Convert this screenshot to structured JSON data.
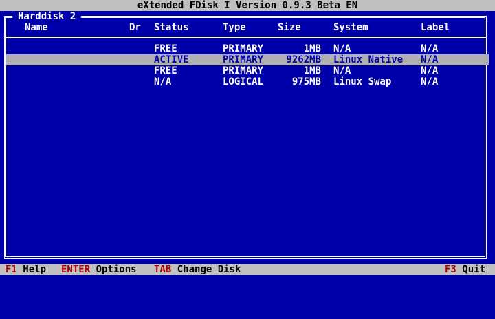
{
  "app": {
    "title": "eXtended FDisk I Version 0.9.3 Beta EN"
  },
  "panel": {
    "title": "Harddisk 2",
    "columns": {
      "name": "Name",
      "drive": "Dr",
      "status": "Status",
      "type": "Type",
      "size": "Size",
      "system": "System",
      "label": "Label"
    },
    "rows": [
      {
        "name": "",
        "drive": "",
        "status": "FREE",
        "type": "PRIMARY",
        "size": "1MB",
        "system": "N/A",
        "label": "N/A"
      },
      {
        "name": "",
        "drive": "",
        "status": "ACTIVE",
        "type": "PRIMARY",
        "size": "9262MB",
        "system": "Linux Native",
        "label": "N/A"
      },
      {
        "name": "",
        "drive": "",
        "status": "FREE",
        "type": "PRIMARY",
        "size": "1MB",
        "system": "N/A",
        "label": "N/A"
      },
      {
        "name": "",
        "drive": "",
        "status": "N/A",
        "type": "LOGICAL",
        "size": "975MB",
        "system": "Linux Swap",
        "label": "N/A"
      }
    ],
    "selected_row_index": 1
  },
  "footer": {
    "f1_key": "F1",
    "f1_label": "Help",
    "enter_key": "ENTER",
    "enter_label": "Options",
    "tab_key": "TAB",
    "tab_label": "Change Disk",
    "f3_key": "F3",
    "f3_label": "Quit"
  },
  "colors": {
    "background": "#0000aa",
    "bar": "#c0c0c0",
    "selection": "#b0b0b0",
    "key_highlight": "#aa0000",
    "text": "#ffffff"
  }
}
